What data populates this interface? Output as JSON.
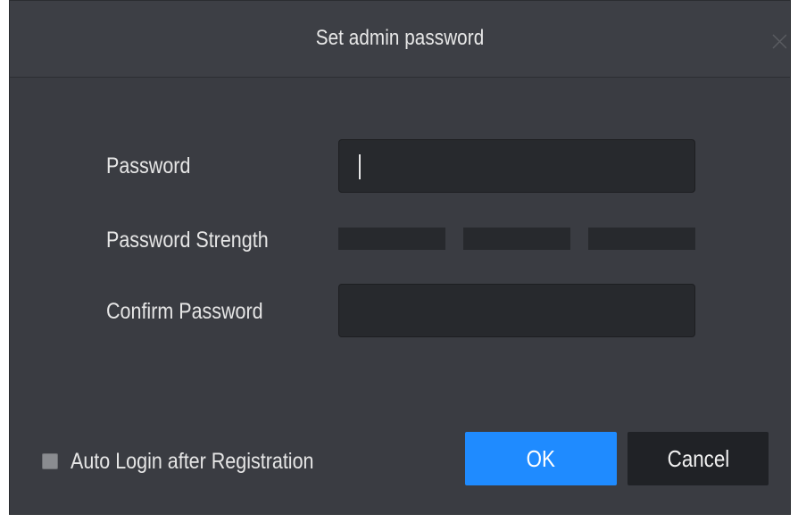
{
  "dialog": {
    "title": "Set admin password",
    "close_icon": "close-icon"
  },
  "form": {
    "password_label": "Password",
    "password_value": "",
    "strength_label": "Password Strength",
    "strength_level": 0,
    "strength_segments": 3,
    "confirm_label": "Confirm Password",
    "confirm_value": ""
  },
  "footer": {
    "auto_login_label": "Auto Login after Registration",
    "auto_login_checked": false,
    "ok_label": "OK",
    "cancel_label": "Cancel"
  },
  "colors": {
    "background": "#3a3c42",
    "field": "#27292d",
    "primary_button": "#1f8bff",
    "secondary_button": "#202226",
    "text": "#e6e6e6"
  }
}
